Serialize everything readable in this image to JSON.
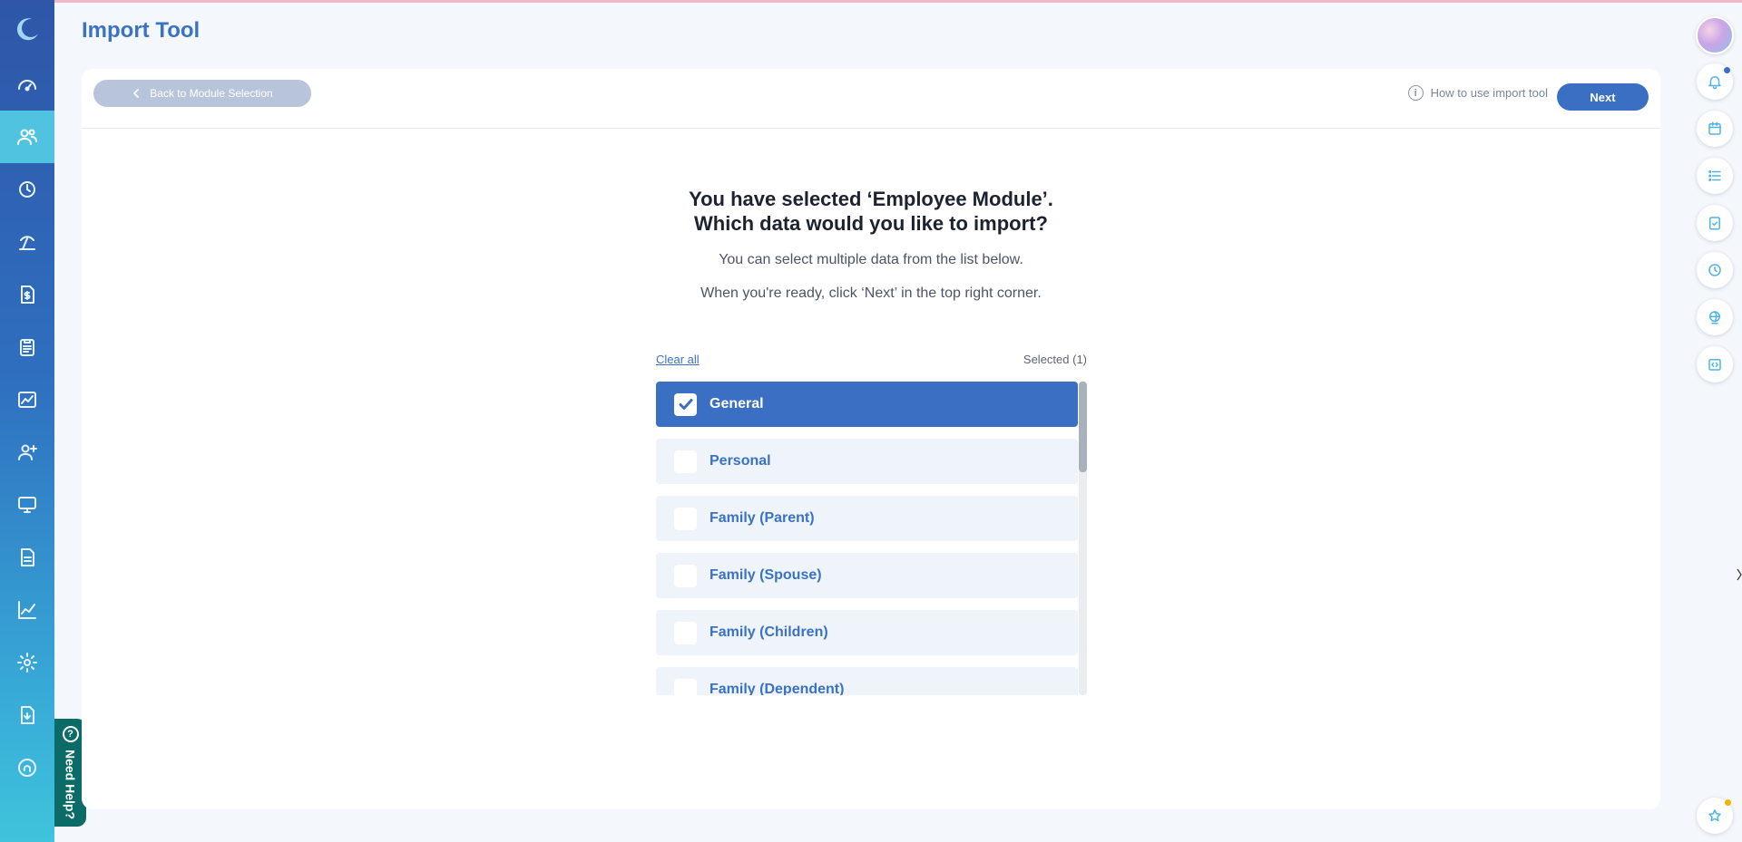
{
  "page": {
    "title": "Import Tool"
  },
  "header": {
    "back_label": "Back to Module Selection",
    "howto_label": "How to use import tool",
    "next_label": "Next"
  },
  "content": {
    "heading_line1": "You have selected ‘Employee Module’.",
    "heading_line2": "Which data would you like to import?",
    "subtext1": "You can select multiple data from the list below.",
    "subtext2": "When you're ready, click ‘Next’ in the top right corner.",
    "clear_all": "Clear all",
    "selected_count": "Selected (1)"
  },
  "data_items": [
    {
      "label": "General",
      "checked": true
    },
    {
      "label": "Personal",
      "checked": false
    },
    {
      "label": "Family (Parent)",
      "checked": false
    },
    {
      "label": "Family (Spouse)",
      "checked": false
    },
    {
      "label": "Family (Children)",
      "checked": false
    },
    {
      "label": "Family (Dependent)",
      "checked": false
    }
  ],
  "sidebar": {
    "items": [
      {
        "icon": "dashboard-gauge-icon"
      },
      {
        "icon": "employees-icon",
        "active": true
      },
      {
        "icon": "time-history-icon"
      },
      {
        "icon": "leave-icon"
      },
      {
        "icon": "payroll-icon"
      },
      {
        "icon": "claims-clipboard-icon"
      },
      {
        "icon": "reports-chart-icon"
      },
      {
        "icon": "recruitment-add-user-icon"
      },
      {
        "icon": "training-monitor-icon"
      },
      {
        "icon": "documents-icon"
      },
      {
        "icon": "analytics-icon"
      },
      {
        "icon": "settings-gear-icon"
      },
      {
        "icon": "import-file-icon"
      },
      {
        "icon": "security-icon"
      }
    ]
  },
  "need_help": {
    "label": "Need Help?"
  },
  "colors": {
    "primary": "#3a6fc4",
    "sidebar_active": "#4fc3e0",
    "help_tab": "#0b6b66"
  }
}
